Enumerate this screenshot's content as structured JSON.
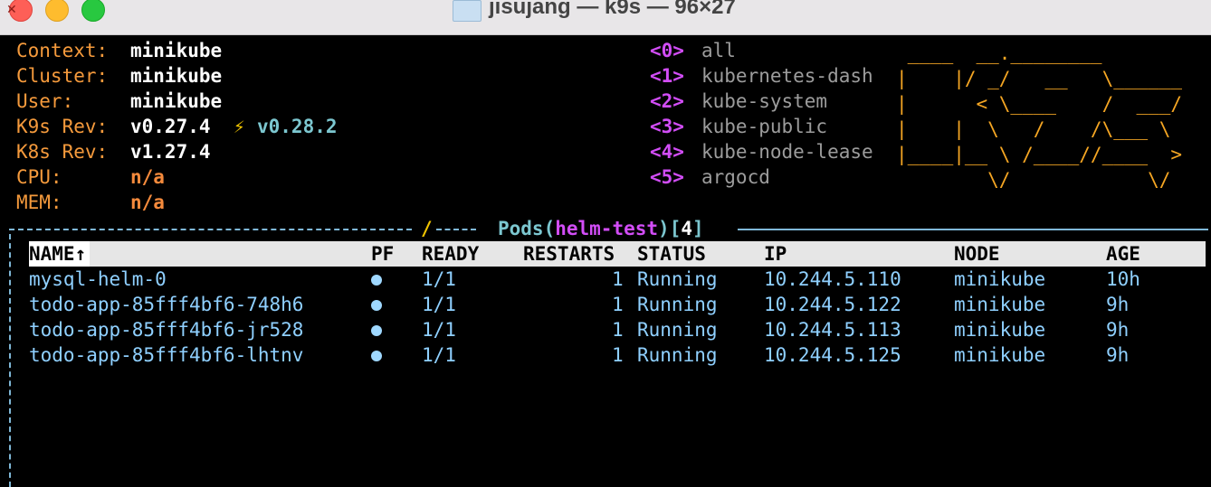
{
  "window": {
    "title": "jisujang — k9s — 96×27"
  },
  "info": {
    "labels": [
      "Context:",
      "Cluster:",
      "User:",
      "K9s Rev:",
      "K8s Rev:",
      "CPU:",
      "MEM:"
    ],
    "context": "minikube",
    "cluster": "minikube",
    "user": "minikube",
    "k9s_rev": "v0.27.4",
    "k9s_update_icon": "lightning-icon",
    "k9s_update": "v0.28.2",
    "k8s_rev": "v1.27.4",
    "cpu": "n/a",
    "mem": "n/a"
  },
  "namespaces": [
    {
      "key": "<0>",
      "name": "all"
    },
    {
      "key": "<1>",
      "name": "kubernetes-dash"
    },
    {
      "key": "<2>",
      "name": "kube-system"
    },
    {
      "key": "<3>",
      "name": "kube-public"
    },
    {
      "key": "<4>",
      "name": "kube-node-lease"
    },
    {
      "key": "<5>",
      "name": "argocd"
    }
  ],
  "logo": " ____  __.________\n|    |/ _/   __   \\______\n|      < \\____    /  ___/\n|    |  \\   /    /\\___ \\\n|____|__ \\ /____//____  >\n        \\/            \\/",
  "pods_title": {
    "resource": "Pods",
    "open": "(",
    "namespace": "helm-test",
    "close": ")",
    "lbracket": "[",
    "count": "4",
    "rbracket": "]"
  },
  "table": {
    "headers": [
      "NAME↑",
      "PF",
      "READY",
      "RESTARTS",
      "STATUS",
      "IP",
      "NODE",
      "AGE"
    ],
    "rows": [
      {
        "name": "mysql-helm-0",
        "ready": "1/1",
        "restarts": "1",
        "status": "Running",
        "ip": "10.244.5.110",
        "node": "minikube",
        "age": "10h"
      },
      {
        "name": "todo-app-85fff4bf6-748h6",
        "ready": "1/1",
        "restarts": "1",
        "status": "Running",
        "ip": "10.244.5.122",
        "node": "minikube",
        "age": "9h"
      },
      {
        "name": "todo-app-85fff4bf6-jr528",
        "ready": "1/1",
        "restarts": "1",
        "status": "Running",
        "ip": "10.244.5.113",
        "node": "minikube",
        "age": "9h"
      },
      {
        "name": "todo-app-85fff4bf6-lhtnv",
        "ready": "1/1",
        "restarts": "1",
        "status": "Running",
        "ip": "10.244.5.125",
        "node": "minikube",
        "age": "9h"
      }
    ]
  },
  "colors": {
    "label": "#f59a3c",
    "value": "#ffffff",
    "ns_key": "#d24df7",
    "ns_name": "#9c9c9c",
    "logo": "#f5a623",
    "rows": "#8fd0ff",
    "frame": "#7fb8d8",
    "header_bg": "#e6e6e6"
  }
}
